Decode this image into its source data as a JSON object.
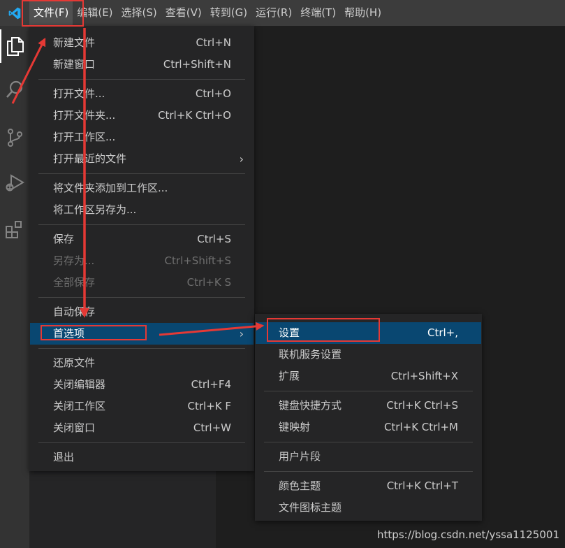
{
  "menubar": {
    "items": [
      "文件(F)",
      "编辑(E)",
      "选择(S)",
      "查看(V)",
      "转到(G)",
      "运行(R)",
      "终端(T)",
      "帮助(H)"
    ]
  },
  "activity_icons": [
    "files-icon",
    "search-icon",
    "source-control-icon",
    "run-debug-icon",
    "extensions-icon"
  ],
  "file_menu": {
    "groups": [
      [
        {
          "label": "新建文件",
          "key": "Ctrl+N"
        },
        {
          "label": "新建窗口",
          "key": "Ctrl+Shift+N"
        }
      ],
      [
        {
          "label": "打开文件...",
          "key": "Ctrl+O"
        },
        {
          "label": "打开文件夹...",
          "key": "Ctrl+K Ctrl+O"
        },
        {
          "label": "打开工作区...",
          "key": ""
        },
        {
          "label": "打开最近的文件",
          "key": "",
          "submenu": true
        }
      ],
      [
        {
          "label": "将文件夹添加到工作区...",
          "key": ""
        },
        {
          "label": "将工作区另存为...",
          "key": ""
        }
      ],
      [
        {
          "label": "保存",
          "key": "Ctrl+S"
        },
        {
          "label": "另存为...",
          "key": "Ctrl+Shift+S",
          "disabled": true
        },
        {
          "label": "全部保存",
          "key": "Ctrl+K S",
          "disabled": true
        }
      ],
      [
        {
          "label": "自动保存",
          "key": ""
        },
        {
          "label": "首选项",
          "key": "",
          "submenu": true,
          "highlight": true
        }
      ],
      [
        {
          "label": "还原文件",
          "key": ""
        },
        {
          "label": "关闭编辑器",
          "key": "Ctrl+F4"
        },
        {
          "label": "关闭工作区",
          "key": "Ctrl+K F"
        },
        {
          "label": "关闭窗口",
          "key": "Ctrl+W"
        }
      ],
      [
        {
          "label": "退出",
          "key": ""
        }
      ]
    ]
  },
  "preferences_menu": {
    "groups": [
      [
        {
          "label": "设置",
          "key": "Ctrl+,",
          "highlight": true
        },
        {
          "label": "联机服务设置",
          "key": ""
        },
        {
          "label": "扩展",
          "key": "Ctrl+Shift+X"
        }
      ],
      [
        {
          "label": "键盘快捷方式",
          "key": "Ctrl+K Ctrl+S"
        },
        {
          "label": "键映射",
          "key": "Ctrl+K Ctrl+M"
        }
      ],
      [
        {
          "label": "用户片段",
          "key": ""
        }
      ],
      [
        {
          "label": "颜色主题",
          "key": "Ctrl+K Ctrl+T"
        },
        {
          "label": "文件图标主题",
          "key": ""
        }
      ]
    ]
  },
  "watermark": "https://blog.csdn.net/yssa1125001",
  "colors": {
    "highlight": "#094771",
    "annotation": "#e53935",
    "logo": "#23a9f2"
  }
}
